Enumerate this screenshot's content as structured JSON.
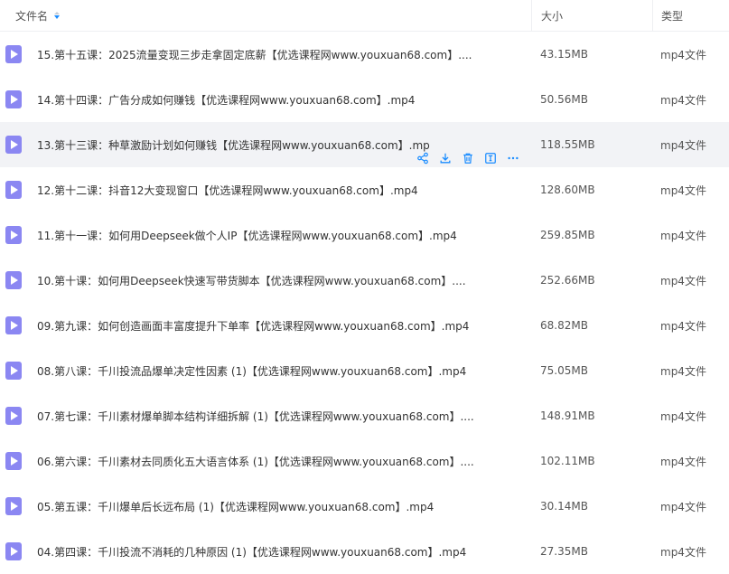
{
  "header": {
    "name": "文件名",
    "size": "大小",
    "type": "类型"
  },
  "accent_color": "#1a8cff",
  "file_icon_color": "#8b87f2",
  "files": [
    {
      "name": "15.第十五课：2025流量变现三步走拿固定底薪【优选课程网www.youxuan68.com】....",
      "size": "43.15MB",
      "type": "mp4文件"
    },
    {
      "name": "14.第十四课：广告分成如何赚钱【优选课程网www.youxuan68.com】.mp4",
      "size": "50.56MB",
      "type": "mp4文件"
    },
    {
      "name": "13.第十三课：种草激励计划如何赚钱【优选课程网www.youxuan68.com】.mp",
      "size": "118.55MB",
      "type": "mp4文件",
      "hover": true
    },
    {
      "name": "12.第十二课：抖音12大变现窗口【优选课程网www.youxuan68.com】.mp4",
      "size": "128.60MB",
      "type": "mp4文件"
    },
    {
      "name": "11.第十一课：如何用Deepseek做个人IP【优选课程网www.youxuan68.com】.mp4",
      "size": "259.85MB",
      "type": "mp4文件"
    },
    {
      "name": "10.第十课：如何用Deepseek快速写带货脚本【优选课程网www.youxuan68.com】....",
      "size": "252.66MB",
      "type": "mp4文件"
    },
    {
      "name": "09.第九课：如何创造画面丰富度提升下单率【优选课程网www.youxuan68.com】.mp4",
      "size": "68.82MB",
      "type": "mp4文件"
    },
    {
      "name": "08.第八课：千川投流品爆单决定性因素 (1)【优选课程网www.youxuan68.com】.mp4",
      "size": "75.05MB",
      "type": "mp4文件"
    },
    {
      "name": "07.第七课：千川素材爆单脚本结构详细拆解 (1)【优选课程网www.youxuan68.com】....",
      "size": "148.91MB",
      "type": "mp4文件"
    },
    {
      "name": "06.第六课：千川素材去同质化五大语言体系 (1)【优选课程网www.youxuan68.com】....",
      "size": "102.11MB",
      "type": "mp4文件"
    },
    {
      "name": "05.第五课：千川爆单后长远布局 (1)【优选课程网www.youxuan68.com】.mp4",
      "size": "30.14MB",
      "type": "mp4文件"
    },
    {
      "name": "04.第四课：千川投流不消耗的几种原因 (1)【优选课程网www.youxuan68.com】.mp4",
      "size": "27.35MB",
      "type": "mp4文件"
    }
  ],
  "row_actions": [
    "share-icon",
    "download-icon",
    "delete-icon",
    "rename-icon",
    "more-icon"
  ]
}
